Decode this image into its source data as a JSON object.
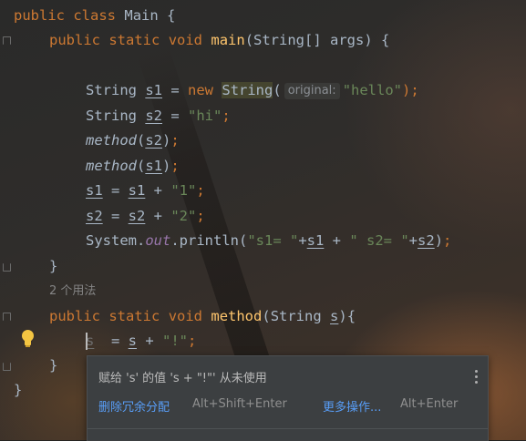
{
  "editor": {
    "kw_public": "public",
    "kw_class": "class",
    "kw_static": "static",
    "kw_void": "void",
    "kw_new": "new",
    "class_name": "Main",
    "main_method": "main",
    "main_params": "(String[] args) {",
    "open_brace": "{",
    "close_brace": "}",
    "type_string": "String",
    "var_s1": "s1",
    "var_s2": "s2",
    "param_hint": "original:",
    "str_hello": "\"hello\"",
    "str_hi": "\"hi\"",
    "method_name": "method",
    "str_1": "\"1\"",
    "str_2": "\"2\"",
    "system": "System.",
    "out": "out",
    "println": ".println(",
    "str_s1eq": "\"s1= \"",
    "str_s2eq": "\" s2= \"",
    "usage_hint": "2 个用法",
    "method_sig_rest": "(String ",
    "param_s": "s",
    "str_bang": "\"!\""
  },
  "popup": {
    "message": "赋给 's' 的值 's + \"!\"' 从未使用",
    "action1_label": "删除冗余分配",
    "action1_shortcut": "Alt+Shift+Enter",
    "action2_label": "更多操作...",
    "action2_shortcut": "Alt+Enter"
  }
}
